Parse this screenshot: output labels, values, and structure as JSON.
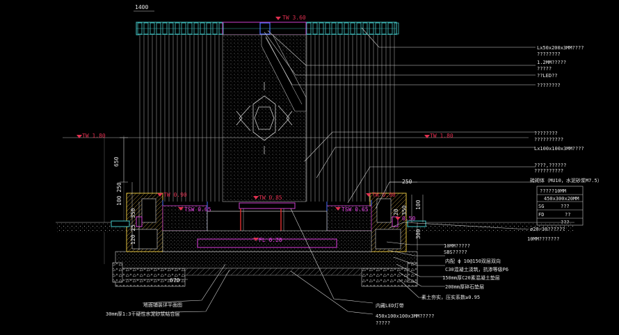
{
  "dims": {
    "top_small": "1400",
    "d650": "650",
    "d100_250": "100 250",
    "d350_left": "350",
    "d120_25": "120 25",
    "d670": "670",
    "d250": "250",
    "d350_right": "350",
    "d20": "20",
    "d100": "100",
    "d300": "300"
  },
  "level_marks": {
    "tw_top": "TW 3.60",
    "tw_left_high": "TW 1.80",
    "tw_right_high": "TW 1.80",
    "tw_left_low": "TW 0.90",
    "tw_right_low": "TW 0.90",
    "tw_center": "TW 0.85",
    "tsw_left": "TSW 0.65",
    "tsw_right": "TSW 0.65",
    "fl_center": "FL 0.20",
    "tw_right_small": "0.50"
  },
  "callouts_right": [
    {
      "text": "Lx50x200x3MM????"
    },
    {
      "text": "????????"
    },
    {
      "text": "1.2MM?????"
    },
    {
      "text": "?????"
    },
    {
      "text": "??LED??"
    },
    {
      "text": "????????"
    },
    {
      "text": "????????"
    },
    {
      "text": "??????????"
    },
    {
      "text": "Lx100x100x3MM????"
    },
    {
      "text": "????,??????"
    },
    {
      "text": "??????????"
    },
    {
      "text": "砖砌体（MU10，水泥砂浆M7.5）"
    },
    {
      "text": "?????10MM"
    },
    {
      "text": "450x300x20MM"
    },
    {
      "text": "ø20~30??????"
    },
    {
      "text": "10MM???????"
    },
    {
      "text": "10MM?????"
    },
    {
      "text": "SBS?????"
    },
    {
      "text": "内配 ф 10@150双层双向"
    },
    {
      "text": "C30混凝土浇筑，抗渗等级P6"
    },
    {
      "text": "150mm厚C20素混凝土垫层"
    },
    {
      "text": "200mm厚碎石垫层"
    },
    {
      "text": "素土夯实，压实系数≥0.95"
    }
  ],
  "table_rows": [
    {
      "k": "SG",
      "v": "???"
    },
    {
      "k": "FD",
      "v": "??"
    },
    {
      "k": "",
      "v": "???"
    }
  ],
  "callouts_bottom": {
    "left1": "地面铺装详平面图",
    "left2": "30mm厚1:3干硬性水泥砂浆结合层",
    "right1": "内藏LED灯带",
    "right2": "450x100x100x3MM?????",
    "right3": "?????"
  }
}
